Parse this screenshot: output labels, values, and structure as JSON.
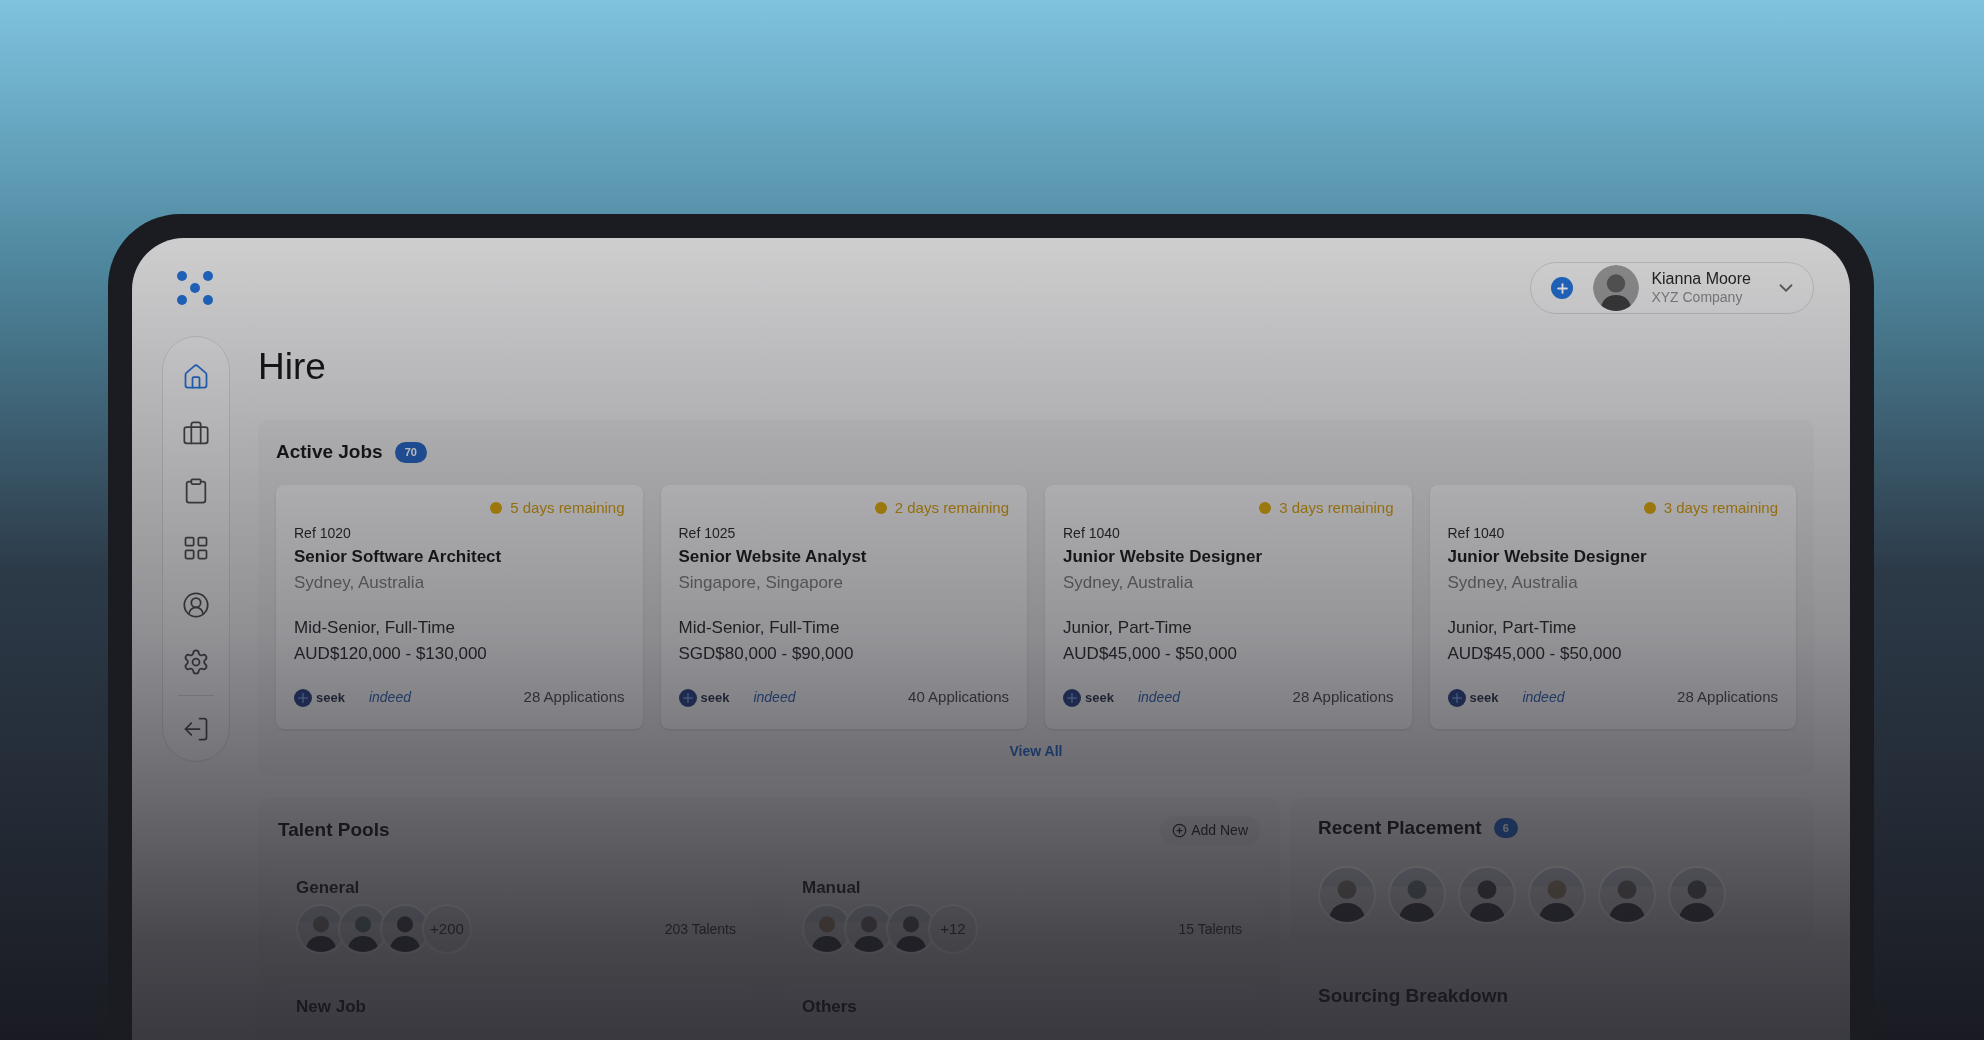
{
  "header": {
    "user": {
      "name": "Kianna Moore",
      "company": "XYZ Company"
    }
  },
  "sidebar": {
    "items": [
      {
        "kind": "home",
        "selected": true
      },
      {
        "kind": "briefcase",
        "selected": false
      },
      {
        "kind": "clipboard",
        "selected": false
      },
      {
        "kind": "grid",
        "selected": false
      },
      {
        "kind": "profile",
        "selected": false
      },
      {
        "kind": "settings",
        "selected": false
      },
      {
        "kind": "logout",
        "selected": false
      }
    ]
  },
  "page_title": "Hire",
  "active_jobs": {
    "title": "Active Jobs",
    "count": "70",
    "view_all": "View All",
    "jobs": [
      {
        "remaining": "5 days remaining",
        "ref": "Ref 1020",
        "title": "Senior Software Architect",
        "location": "Sydney, Australia",
        "level": "Mid-Senior, Full-Time",
        "salary": "AUD$120,000 - $130,000",
        "boards": [
          "seek",
          "indeed"
        ],
        "applications": "28 Applications"
      },
      {
        "remaining": "2 days remaining",
        "ref": "Ref 1025",
        "title": "Senior Website Analyst",
        "location": "Singapore, Singapore",
        "level": "Mid-Senior, Full-Time",
        "salary": "SGD$80,000 - $90,000",
        "boards": [
          "seek",
          "indeed"
        ],
        "applications": "40 Applications"
      },
      {
        "remaining": "3 days remaining",
        "ref": "Ref 1040",
        "title": "Junior Website Designer",
        "location": "Sydney, Australia",
        "level": "Junior, Part-Time",
        "salary": "AUD$45,000 - $50,000",
        "boards": [
          "seek",
          "indeed"
        ],
        "applications": "28 Applications"
      },
      {
        "remaining": "3 days remaining",
        "ref": "Ref 1040",
        "title": "Junior Website Designer",
        "location": "Sydney, Australia",
        "level": "Junior, Part-Time",
        "salary": "AUD$45,000 - $50,000",
        "boards": [
          "seek",
          "indeed"
        ],
        "applications": "28 Applications"
      }
    ]
  },
  "talent_pools": {
    "title": "Talent Pools",
    "add_button": "Add New",
    "pools": [
      {
        "name": "General",
        "more": "+200",
        "talents": "203 Talents"
      },
      {
        "name": "Manual",
        "more": "+12",
        "talents": "15 Talents"
      },
      {
        "name": "New Job"
      },
      {
        "name": "Others"
      }
    ]
  },
  "recent_placement": {
    "title": "Recent Placement",
    "count": "6"
  },
  "sourcing": {
    "title": "Sourcing Breakdown"
  }
}
